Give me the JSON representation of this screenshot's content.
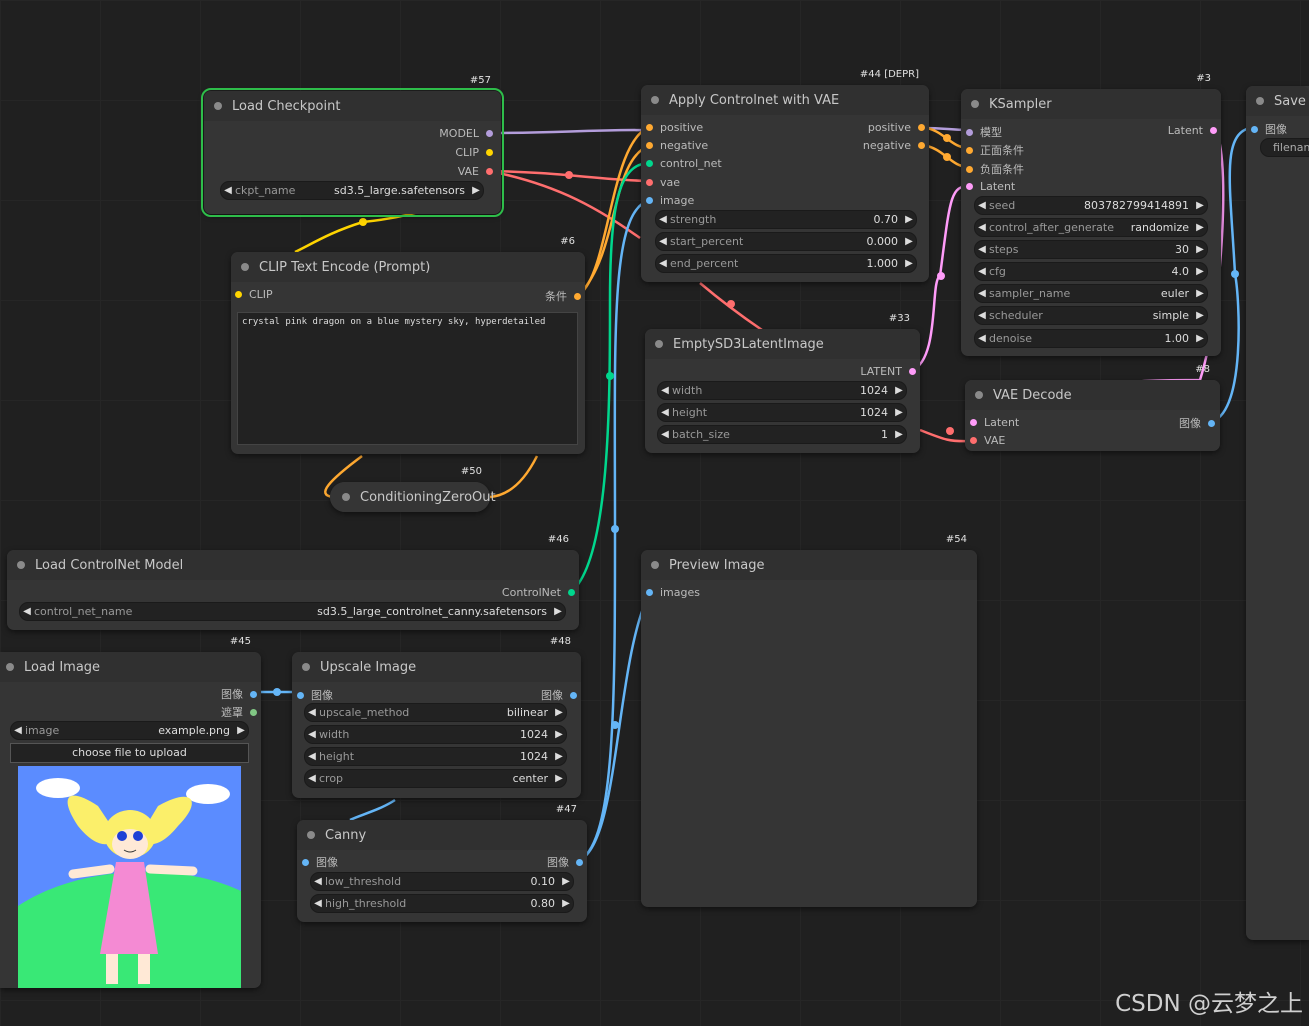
{
  "colors": {
    "model": "#b39ddb",
    "clip": "#ffd500",
    "vae": "#ff6e6e",
    "conditioning": "#ffa931",
    "control_net": "#00d78d",
    "image": "#64b5f6",
    "latent": "#ff9cf9",
    "mask": "#81c784",
    "selected": "#2ebd4a"
  },
  "nodes": {
    "load_checkpoint": {
      "id": "#57",
      "title": "Load Checkpoint",
      "out_model": "MODEL",
      "out_clip": "CLIP",
      "out_vae": "VAE",
      "w_ckpt_label": "ckpt_name",
      "w_ckpt_value": "sd3.5_large.safetensors"
    },
    "apply_controlnet": {
      "id": "#44 [DEPR]",
      "title": "Apply Controlnet with VAE",
      "in_positive": "positive",
      "in_negative": "negative",
      "in_control_net": "control_net",
      "in_vae": "vae",
      "in_image": "image",
      "out_positive": "positive",
      "out_negative": "negative",
      "w_strength_label": "strength",
      "w_strength_value": "0.70",
      "w_start_label": "start_percent",
      "w_start_value": "0.000",
      "w_end_label": "end_percent",
      "w_end_value": "1.000"
    },
    "ksampler": {
      "id": "#3",
      "title": "KSampler",
      "in_model": "模型",
      "in_positive": "正面条件",
      "in_negative": "负面条件",
      "in_latent": "Latent",
      "out_latent": "Latent",
      "w_seed_label": "seed",
      "w_seed_value": "803782799414891",
      "w_control_label": "control_after_generate",
      "w_control_value": "randomize",
      "w_steps_label": "steps",
      "w_steps_value": "30",
      "w_cfg_label": "cfg",
      "w_cfg_value": "4.0",
      "w_sampler_label": "sampler_name",
      "w_sampler_value": "euler",
      "w_scheduler_label": "scheduler",
      "w_scheduler_value": "simple",
      "w_denoise_label": "denoise",
      "w_denoise_value": "1.00"
    },
    "save": {
      "title": "Save I",
      "in_image": "图像",
      "w_filename": "filenam"
    },
    "clip_text": {
      "id": "#6",
      "title": "CLIP Text Encode (Prompt)",
      "in_clip": "CLIP",
      "out_cond": "条件",
      "text": "crystal pink dragon on a blue mystery sky, hyperdetailed"
    },
    "empty_latent": {
      "id": "#33",
      "title": "EmptySD3LatentImage",
      "out_latent": "LATENT",
      "w_width_label": "width",
      "w_width_value": "1024",
      "w_height_label": "height",
      "w_height_value": "1024",
      "w_batch_label": "batch_size",
      "w_batch_value": "1"
    },
    "vae_decode": {
      "id": "#8",
      "title": "VAE Decode",
      "in_latent": "Latent",
      "in_vae": "VAE",
      "out_image": "图像"
    },
    "cond_zero": {
      "id": "#50",
      "title": "ConditioningZeroOut"
    },
    "load_controlnet": {
      "id": "#46",
      "title": "Load ControlNet Model",
      "out_cn": "ControlNet",
      "w_label": "control_net_name",
      "w_value": "sd3.5_large_controlnet_canny.safetensors"
    },
    "preview": {
      "id": "#54",
      "title": "Preview Image",
      "in_images": "images"
    },
    "load_image": {
      "id": "#45",
      "title": "Load Image",
      "out_image": "图像",
      "out_mask": "遮罩",
      "w_label": "image",
      "w_value": "example.png",
      "upload": "choose file to upload"
    },
    "upscale": {
      "id": "#48",
      "title": "Upscale Image",
      "in_image": "图像",
      "out_image": "图像",
      "w_method_label": "upscale_method",
      "w_method_value": "bilinear",
      "w_width_label": "width",
      "w_width_value": "1024",
      "w_height_label": "height",
      "w_height_value": "1024",
      "w_crop_label": "crop",
      "w_crop_value": "center"
    },
    "canny": {
      "id": "#47",
      "title": "Canny",
      "in_image": "图像",
      "out_image": "图像",
      "w_low_label": "low_threshold",
      "w_low_value": "0.10",
      "w_high_label": "high_threshold",
      "w_high_value": "0.80"
    }
  },
  "watermark": "CSDN @云梦之上"
}
